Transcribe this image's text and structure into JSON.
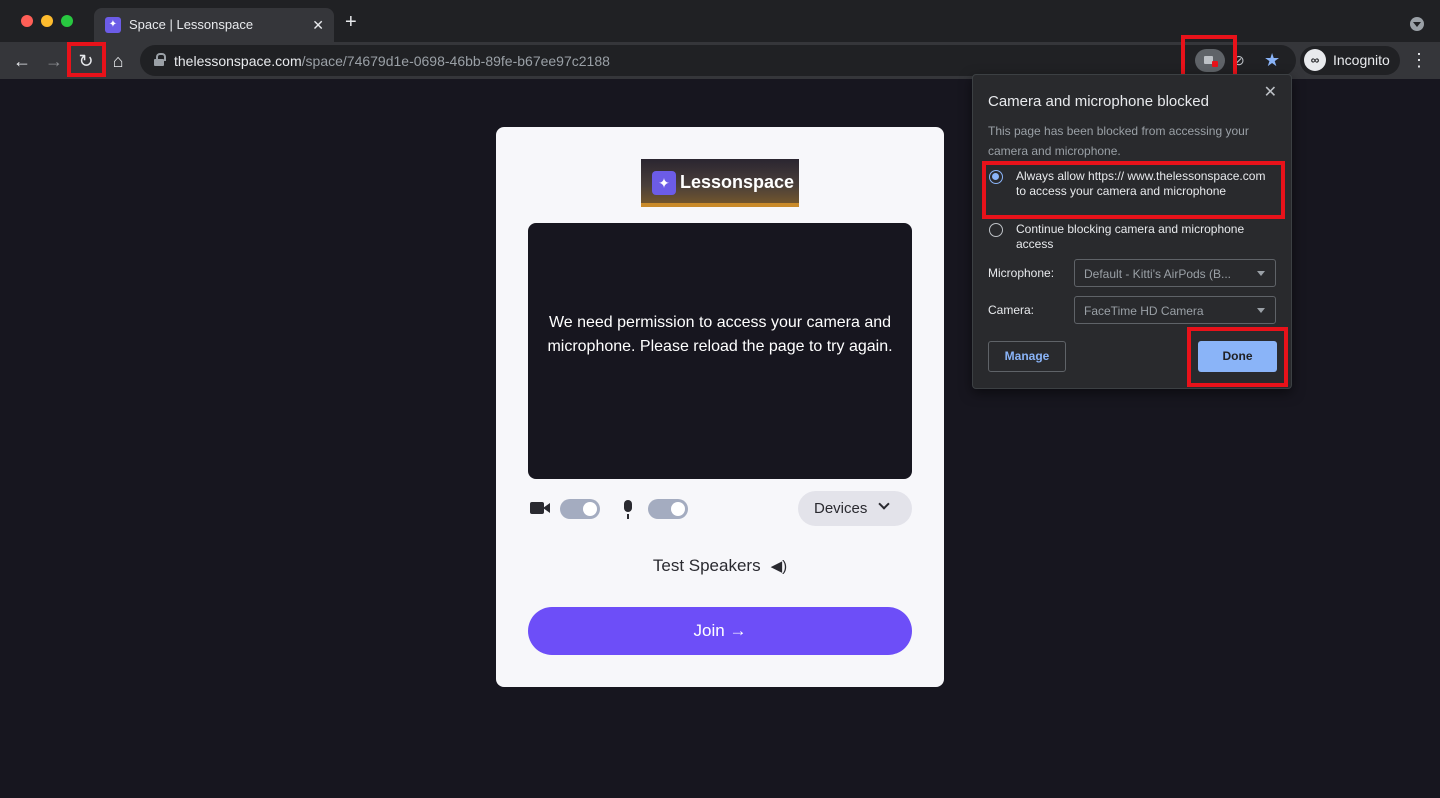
{
  "browser": {
    "tab": {
      "title": "Space | Lessonspace"
    },
    "url": {
      "domain": "thelessonspace.com",
      "path": "/space/74679d1e-0698-46bb-89fe-b67ee97c2188"
    },
    "profile_label": "Incognito",
    "icons": {
      "back": "←",
      "forward": "→",
      "reload": "↻",
      "home": "⌂",
      "new_tab": "+",
      "close": "✕",
      "star": "★",
      "eye_off": "⊘",
      "menu": "⋮",
      "incognito": "∞"
    }
  },
  "page": {
    "logo_text": "Lessonspace",
    "logo_mark": "✦",
    "preview_message": "We need permission to access your camera and microphone. Please reload the page to try again.",
    "devices_label": "Devices",
    "test_speakers_label": "Test Speakers",
    "speaker_icon": "◀)",
    "join_label": "Join →",
    "camera_enabled": true,
    "mic_enabled": true
  },
  "popup": {
    "title": "Camera and microphone blocked",
    "description": "This page has been blocked from accessing your camera and microphone.",
    "options": [
      {
        "label": "Always allow https:// www.thelessonspace.com to access your camera and microphone",
        "selected": true
      },
      {
        "label": "Continue blocking camera and microphone access",
        "selected": false
      }
    ],
    "microphone_label": "Microphone:",
    "microphone_value": "Default - Kitti's AirPods (B...",
    "camera_label": "Camera:",
    "camera_value": "FaceTime HD Camera",
    "manage_label": "Manage",
    "done_label": "Done"
  },
  "colors": {
    "accent": "#6d4ef8",
    "highlight_box": "#e8121a",
    "chrome_link": "#8ab4f8"
  }
}
